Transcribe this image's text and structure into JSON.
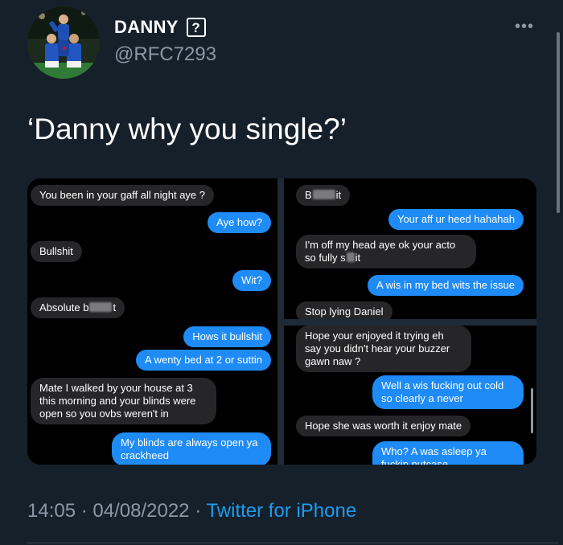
{
  "author": {
    "display_name": "DANNY",
    "badge_glyph": "?",
    "handle": "@RFC7293",
    "avatar_icon": "avatar-photo-footballers"
  },
  "tweet": {
    "text": "‘Danny why you single?’"
  },
  "screenshots": {
    "left": [
      {
        "from": "in",
        "text": "You been in your gaff all night aye ?"
      },
      {
        "from": "out",
        "text": "Aye how?"
      },
      {
        "from": "in",
        "text": "Bullshit"
      },
      {
        "from": "out",
        "text": "Wit?"
      },
      {
        "from": "in",
        "before": "Absolute b",
        "after": "t"
      },
      {
        "from": "out",
        "text": "Hows it bullshit"
      },
      {
        "from": "out",
        "text": "A wenty bed at 2 or suttin"
      },
      {
        "from": "in",
        "text": "Mate I walked by your house at 3 this morning and your blinds were open so you ovbs weren't in"
      },
      {
        "from": "out",
        "text": "My blinds are always open ya crackheed"
      }
    ],
    "top_right": [
      {
        "from": "in",
        "before": "B",
        "after": "it"
      },
      {
        "from": "out",
        "text": "Your aff ur heed hahahah"
      },
      {
        "from": "in",
        "before": "I'm off my head aye ok your acto so fully s",
        "after": "it"
      },
      {
        "from": "out",
        "text": "A wis in my bed wits the issue"
      },
      {
        "from": "in",
        "text": "Stop lying Daniel"
      }
    ],
    "bottom_right": [
      {
        "from": "in",
        "text": "Hope your enjoyed it trying eh say you didn't hear your buzzer gawn naw ?"
      },
      {
        "from": "out",
        "text": "Well a wis fucking out cold so clearly a never"
      },
      {
        "from": "in",
        "text": "Hope she was worth it enjoy mate"
      },
      {
        "from": "out",
        "text": "Who? A was asleep ya fuckin nutcase"
      }
    ]
  },
  "footer": {
    "time": "14:05",
    "dot1": "·",
    "date": "04/08/2022",
    "dot2": "·",
    "source": "Twitter for iPhone"
  },
  "colors": {
    "background": "#15202b",
    "accent": "#1d9bf0",
    "imessage_blue": "#1f8bf7",
    "imessage_gray": "#262628"
  }
}
